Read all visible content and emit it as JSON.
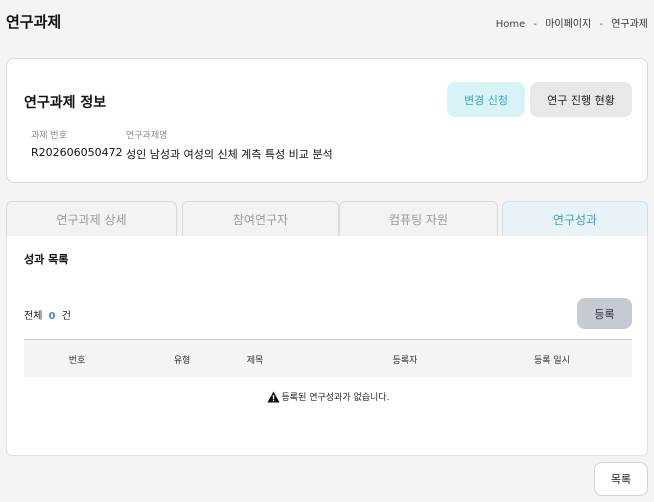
{
  "header": {
    "title": "연구과제",
    "breadcrumb": [
      "Home",
      "마이페이지",
      "연구과제"
    ],
    "separator": "-"
  },
  "info": {
    "title": "연구과제 정보",
    "change_button": "변경 신청",
    "status_button": "연구 진행 현황",
    "fields": [
      {
        "label": "과제 번호",
        "value": "R202606050472"
      },
      {
        "label": "연구과제명",
        "value": "성인 남성과 여성의 신체 계측 특성 비교 분석"
      }
    ]
  },
  "tabs": [
    {
      "label": "연구과제 상세",
      "active": false
    },
    {
      "label": "참여연구자",
      "active": false
    },
    {
      "label": "컴퓨팅 자원",
      "active": false
    },
    {
      "label": "연구성과",
      "active": true
    }
  ],
  "results": {
    "section_title": "성과 목록",
    "total_prefix": "전체",
    "total_count": "0",
    "total_suffix": "건",
    "register_button": "등록",
    "columns": [
      "번호",
      "유형",
      "제목",
      "등록자",
      "등록 일시"
    ],
    "empty_message": "등록된 연구성과가 없습니다."
  },
  "footer": {
    "list_button": "목록"
  },
  "colors": {
    "accent": "#3aa8bd",
    "count": "#2f8fd8"
  }
}
